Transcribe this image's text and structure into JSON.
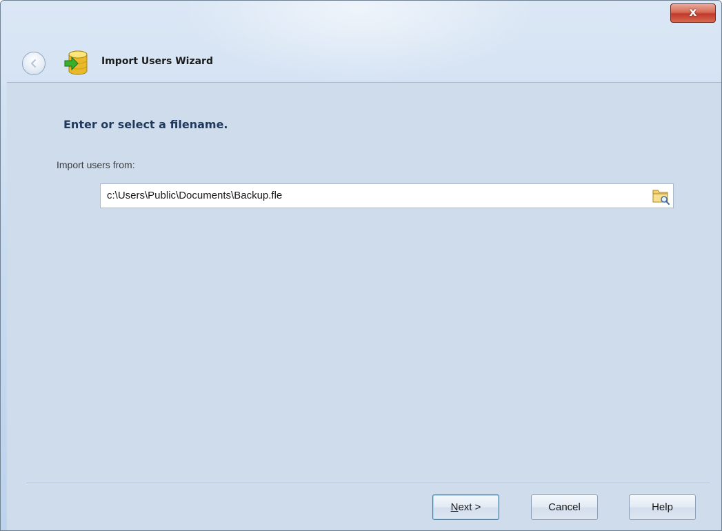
{
  "window": {
    "title": "Import Users Wizard",
    "close_label": "x"
  },
  "icons": {
    "back": "back-arrow-icon",
    "wizard": "database-import-icon",
    "browse": "folder-browse-icon"
  },
  "page": {
    "heading": "Enter or select a filename.",
    "field_label": "Import users from:",
    "file_path": "c:\\Users\\Public\\Documents\\Backup.fle"
  },
  "buttons": {
    "next_mnemonic": "N",
    "next_rest": "ext >",
    "cancel": "Cancel",
    "help": "Help"
  },
  "colors": {
    "content_bg": "#cedcec",
    "heading": "#1e395b",
    "close": "#c0392b"
  }
}
